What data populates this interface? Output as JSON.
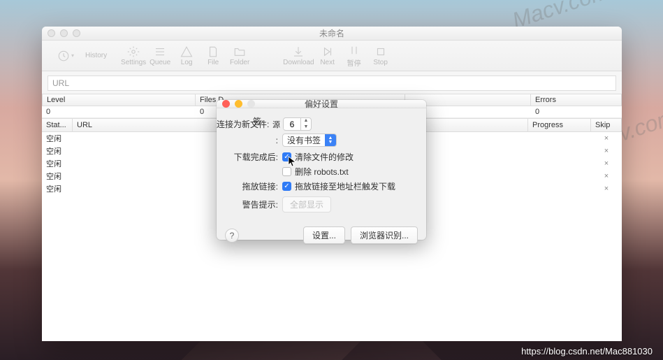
{
  "watermark": "Macv.com",
  "attribution": "https://blog.csdn.net/Mac881030",
  "main_window": {
    "title": "未命名",
    "toolbar": {
      "history": "History",
      "settings": "Settings",
      "queue": "Queue",
      "log": "Log",
      "file": "File",
      "folder": "Folder",
      "download": "Download",
      "next": "Next",
      "pause": "暂停",
      "stop": "Stop"
    },
    "url_label": "URL",
    "stats": {
      "headers": {
        "level": "Level",
        "files": "Files D...",
        "remaining": "...",
        "errors": "Errors"
      },
      "values": {
        "level": "0",
        "files": "0",
        "remaining": "",
        "errors": "0"
      }
    },
    "table": {
      "headers": {
        "status": "Stat...",
        "url": "URL",
        "progress": "Progress",
        "skip": "Skip"
      },
      "rows": [
        {
          "status": "空闲",
          "url": "",
          "progress": "",
          "skip": "×"
        },
        {
          "status": "空闲",
          "url": "",
          "progress": "",
          "skip": "×"
        },
        {
          "status": "空闲",
          "url": "",
          "progress": "",
          "skip": "×"
        },
        {
          "status": "空闲",
          "url": "",
          "progress": "",
          "skip": "×"
        },
        {
          "status": "空闲",
          "url": "",
          "progress": "",
          "skip": "×"
        }
      ]
    }
  },
  "prefs": {
    "title": "偏好设置",
    "row_bookmark_suffix": "签",
    "row_new_bookmark_label": "连接为新文件:",
    "row_new_bookmark_extra": "源",
    "stepper_value": "6",
    "bookmark_select_label": ":",
    "bookmark_select_value": "没有书签",
    "after_download_label": "下载完成后:",
    "chk_clear_label": "清除文件的修改",
    "chk_delete_label": "删除 robots.txt",
    "drag_link_label": "拖放链接:",
    "chk_drag_label": "拖放链接至地址栏触发下载",
    "warn_label": "警告提示:",
    "warn_btn": "全部显示",
    "help": "?",
    "settings_btn": "设置...",
    "browser_btn": "浏览器识别..."
  }
}
